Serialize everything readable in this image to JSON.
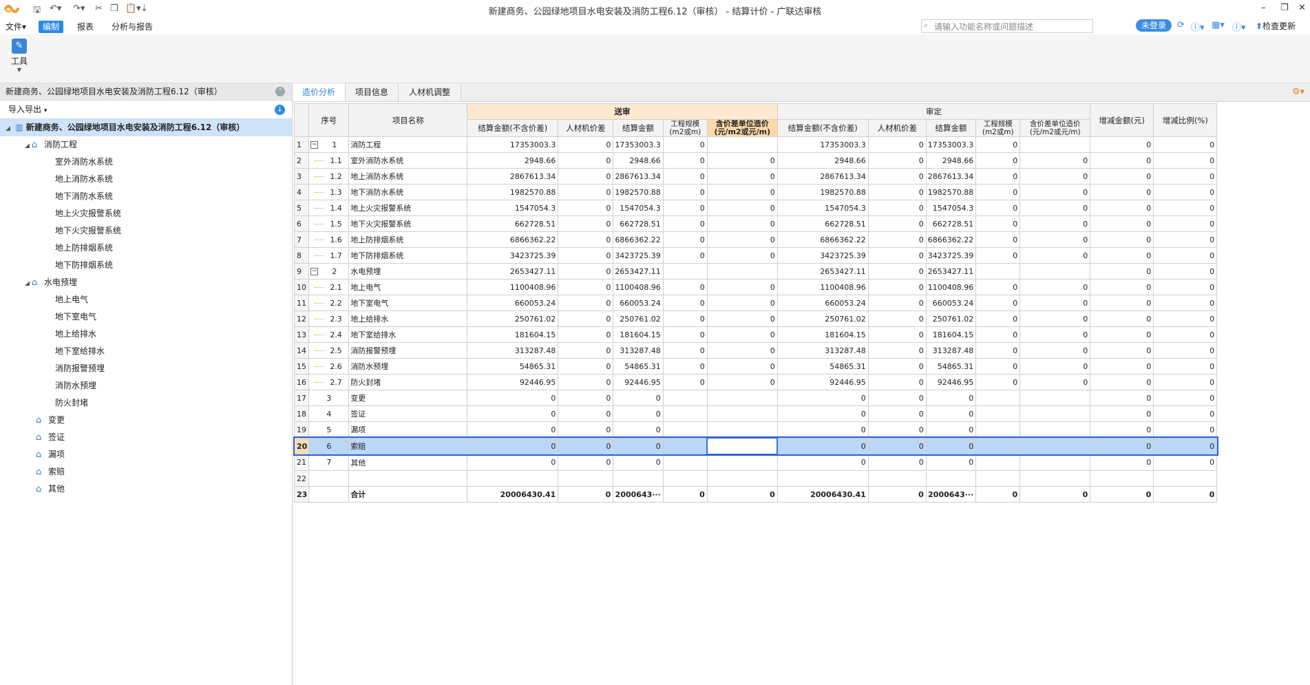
{
  "window": {
    "title": "新建商务、公园绿地项目水电安装及消防工程6.12（审核） - 结算计价 - 广联达审核"
  },
  "menu": {
    "file": "文件",
    "edit": "编制",
    "report": "报表",
    "analysis": "分析与报告"
  },
  "search": {
    "placeholder": "请输入功能名称或问题描述"
  },
  "account": {
    "login": "未登录",
    "update": "检查更新"
  },
  "ribbon": {
    "tool": "工具"
  },
  "left": {
    "header": "新建商务、公园绿地项目水电安装及消防工程6.12（审核）",
    "import": "导入导出",
    "root": "新建商务、公园绿地项目水电安装及消防工程6.12（审核）",
    "nodes": [
      {
        "label": "消防工程",
        "level": 1,
        "type": "folder"
      },
      {
        "label": "室外消防水系统",
        "level": 2,
        "type": "leaf"
      },
      {
        "label": "地上消防水系统",
        "level": 2,
        "type": "leaf"
      },
      {
        "label": "地下消防水系统",
        "level": 2,
        "type": "leaf"
      },
      {
        "label": "地上火灾报警系统",
        "level": 2,
        "type": "leaf"
      },
      {
        "label": "地下火灾报警系统",
        "level": 2,
        "type": "leaf"
      },
      {
        "label": "地上防排烟系统",
        "level": 2,
        "type": "leaf"
      },
      {
        "label": "地下防排烟系统",
        "level": 2,
        "type": "leaf"
      },
      {
        "label": "水电预埋",
        "level": 1,
        "type": "folder"
      },
      {
        "label": "地上电气",
        "level": 2,
        "type": "leaf"
      },
      {
        "label": "地下室电气",
        "level": 2,
        "type": "leaf"
      },
      {
        "label": "地上给排水",
        "level": 2,
        "type": "leaf"
      },
      {
        "label": "地下室给排水",
        "level": 2,
        "type": "leaf"
      },
      {
        "label": "消防报警预埋",
        "level": 2,
        "type": "leaf"
      },
      {
        "label": "消防水预埋",
        "level": 2,
        "type": "leaf"
      },
      {
        "label": "防火封堵",
        "level": 2,
        "type": "leaf"
      },
      {
        "label": "变更",
        "level": 1,
        "type": "house"
      },
      {
        "label": "签证",
        "level": 1,
        "type": "house"
      },
      {
        "label": "漏项",
        "level": 1,
        "type": "house"
      },
      {
        "label": "索赔",
        "level": 1,
        "type": "house"
      },
      {
        "label": "其他",
        "level": 1,
        "type": "house"
      }
    ]
  },
  "tabs": [
    "造价分析",
    "项目信息",
    "人材机调整"
  ],
  "grid": {
    "h_seq": "序号",
    "h_name": "项目名称",
    "h_send": "送审",
    "h_audit": "审定",
    "h_amt_ex": "结算金额(不含价差)",
    "h_lab": "人材机价差",
    "h_amt": "结算金额",
    "h_scale": "工程规模\n(m2或m)",
    "h_unit_send": "含价差单位造价\n(元/m2或元/m)",
    "h_unit_aud": "含价差单位造价\n(元/m2或元/m)",
    "h_inc": "增减金额(元)",
    "h_ratio": "增减比例(%)",
    "rows": [
      {
        "rn": "1",
        "seq": "1",
        "tree": "collapse",
        "name": "消防工程",
        "a": "17353003.3",
        "b": "0",
        "c": "17353003.3",
        "d": "0",
        "e": "",
        "f": "17353003.3",
        "g": "0",
        "h": "17353003.3",
        "i": "0",
        "j": "",
        "k": "0",
        "l": "0"
      },
      {
        "rn": "2",
        "seq": "1.1",
        "tree": "line",
        "name": "室外消防水系统",
        "a": "2948.66",
        "b": "0",
        "c": "2948.66",
        "d": "0",
        "e": "0",
        "f": "2948.66",
        "g": "0",
        "h": "2948.66",
        "i": "0",
        "j": "0",
        "k": "0",
        "l": "0"
      },
      {
        "rn": "3",
        "seq": "1.2",
        "tree": "line",
        "name": "地上消防水系统",
        "a": "2867613.34",
        "b": "0",
        "c": "2867613.34",
        "d": "0",
        "e": "0",
        "f": "2867613.34",
        "g": "0",
        "h": "2867613.34",
        "i": "0",
        "j": "0",
        "k": "0",
        "l": "0"
      },
      {
        "rn": "4",
        "seq": "1.3",
        "tree": "line",
        "name": "地下消防水系统",
        "a": "1982570.88",
        "b": "0",
        "c": "1982570.88",
        "d": "0",
        "e": "0",
        "f": "1982570.88",
        "g": "0",
        "h": "1982570.88",
        "i": "0",
        "j": "0",
        "k": "0",
        "l": "0"
      },
      {
        "rn": "5",
        "seq": "1.4",
        "tree": "line",
        "name": "地上火灾报警系统",
        "a": "1547054.3",
        "b": "0",
        "c": "1547054.3",
        "d": "0",
        "e": "0",
        "f": "1547054.3",
        "g": "0",
        "h": "1547054.3",
        "i": "0",
        "j": "0",
        "k": "0",
        "l": "0"
      },
      {
        "rn": "6",
        "seq": "1.5",
        "tree": "line",
        "name": "地下火灾报警系统",
        "a": "662728.51",
        "b": "0",
        "c": "662728.51",
        "d": "0",
        "e": "0",
        "f": "662728.51",
        "g": "0",
        "h": "662728.51",
        "i": "0",
        "j": "0",
        "k": "0",
        "l": "0"
      },
      {
        "rn": "7",
        "seq": "1.6",
        "tree": "line",
        "name": "地上防排烟系统",
        "a": "6866362.22",
        "b": "0",
        "c": "6866362.22",
        "d": "0",
        "e": "0",
        "f": "6866362.22",
        "g": "0",
        "h": "6866362.22",
        "i": "0",
        "j": "0",
        "k": "0",
        "l": "0"
      },
      {
        "rn": "8",
        "seq": "1.7",
        "tree": "line",
        "name": "地下防排烟系统",
        "a": "3423725.39",
        "b": "0",
        "c": "3423725.39",
        "d": "0",
        "e": "0",
        "f": "3423725.39",
        "g": "0",
        "h": "3423725.39",
        "i": "0",
        "j": "0",
        "k": "0",
        "l": "0"
      },
      {
        "rn": "9",
        "seq": "2",
        "tree": "collapse",
        "name": "水电预埋",
        "a": "2653427.11",
        "b": "0",
        "c": "2653427.11",
        "d": "",
        "e": "",
        "f": "2653427.11",
        "g": "0",
        "h": "2653427.11",
        "i": "",
        "j": "",
        "k": "0",
        "l": "0"
      },
      {
        "rn": "10",
        "seq": "2.1",
        "tree": "line",
        "name": "地上电气",
        "a": "1100408.96",
        "b": "0",
        "c": "1100408.96",
        "d": "0",
        "e": "0",
        "f": "1100408.96",
        "g": "0",
        "h": "1100408.96",
        "i": "0",
        "j": "0",
        "k": "0",
        "l": "0"
      },
      {
        "rn": "11",
        "seq": "2.2",
        "tree": "line",
        "name": "地下室电气",
        "a": "660053.24",
        "b": "0",
        "c": "660053.24",
        "d": "0",
        "e": "0",
        "f": "660053.24",
        "g": "0",
        "h": "660053.24",
        "i": "0",
        "j": "0",
        "k": "0",
        "l": "0"
      },
      {
        "rn": "12",
        "seq": "2.3",
        "tree": "line",
        "name": "地上给排水",
        "a": "250761.02",
        "b": "0",
        "c": "250761.02",
        "d": "0",
        "e": "0",
        "f": "250761.02",
        "g": "0",
        "h": "250761.02",
        "i": "0",
        "j": "0",
        "k": "0",
        "l": "0"
      },
      {
        "rn": "13",
        "seq": "2.4",
        "tree": "line",
        "name": "地下室给排水",
        "a": "181604.15",
        "b": "0",
        "c": "181604.15",
        "d": "0",
        "e": "0",
        "f": "181604.15",
        "g": "0",
        "h": "181604.15",
        "i": "0",
        "j": "0",
        "k": "0",
        "l": "0"
      },
      {
        "rn": "14",
        "seq": "2.5",
        "tree": "line",
        "name": "消防报警预埋",
        "a": "313287.48",
        "b": "0",
        "c": "313287.48",
        "d": "0",
        "e": "0",
        "f": "313287.48",
        "g": "0",
        "h": "313287.48",
        "i": "0",
        "j": "0",
        "k": "0",
        "l": "0"
      },
      {
        "rn": "15",
        "seq": "2.6",
        "tree": "line",
        "name": "消防水预埋",
        "a": "54865.31",
        "b": "0",
        "c": "54865.31",
        "d": "0",
        "e": "0",
        "f": "54865.31",
        "g": "0",
        "h": "54865.31",
        "i": "0",
        "j": "0",
        "k": "0",
        "l": "0"
      },
      {
        "rn": "16",
        "seq": "2.7",
        "tree": "line",
        "name": "防火封堵",
        "a": "92446.95",
        "b": "0",
        "c": "92446.95",
        "d": "0",
        "e": "0",
        "f": "92446.95",
        "g": "0",
        "h": "92446.95",
        "i": "0",
        "j": "0",
        "k": "0",
        "l": "0"
      },
      {
        "rn": "17",
        "seq": "3",
        "tree": "",
        "name": "变更",
        "a": "0",
        "b": "0",
        "c": "0",
        "d": "",
        "e": "",
        "f": "0",
        "g": "0",
        "h": "0",
        "i": "",
        "j": "",
        "k": "0",
        "l": "0"
      },
      {
        "rn": "18",
        "seq": "4",
        "tree": "",
        "name": "签证",
        "a": "0",
        "b": "0",
        "c": "0",
        "d": "",
        "e": "",
        "f": "0",
        "g": "0",
        "h": "0",
        "i": "",
        "j": "",
        "k": "0",
        "l": "0"
      },
      {
        "rn": "19",
        "seq": "5",
        "tree": "",
        "name": "漏项",
        "a": "0",
        "b": "0",
        "c": "0",
        "d": "",
        "e": "",
        "f": "0",
        "g": "0",
        "h": "0",
        "i": "",
        "j": "",
        "k": "0",
        "l": "0"
      },
      {
        "rn": "20",
        "seq": "6",
        "tree": "",
        "name": "索赔",
        "a": "0",
        "b": "0",
        "c": "0",
        "d": "",
        "e": "",
        "f": "0",
        "g": "0",
        "h": "0",
        "i": "",
        "j": "",
        "k": "0",
        "l": "0",
        "selected": true
      },
      {
        "rn": "21",
        "seq": "7",
        "tree": "",
        "name": "其他",
        "a": "0",
        "b": "0",
        "c": "0",
        "d": "",
        "e": "",
        "f": "0",
        "g": "0",
        "h": "0",
        "i": "",
        "j": "",
        "k": "0",
        "l": "0"
      },
      {
        "rn": "22",
        "seq": "",
        "tree": "",
        "name": "",
        "a": "",
        "b": "",
        "c": "",
        "d": "",
        "e": "",
        "f": "",
        "g": "",
        "h": "",
        "i": "",
        "j": "",
        "k": "",
        "l": ""
      },
      {
        "rn": "23",
        "seq": "",
        "tree": "",
        "name": "合计",
        "a": "20006430.41",
        "b": "0",
        "c": "2000643···",
        "d": "0",
        "e": "0",
        "f": "20006430.41",
        "g": "0",
        "h": "2000643···",
        "i": "0",
        "j": "0",
        "k": "0",
        "l": "0",
        "total": true
      }
    ]
  }
}
